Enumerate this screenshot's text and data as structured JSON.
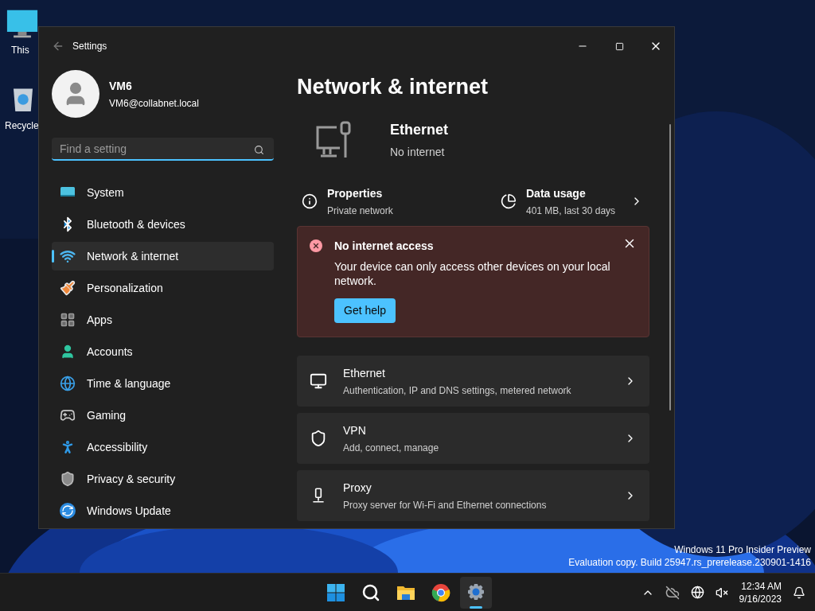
{
  "desktop_icons": [
    {
      "label": "This"
    },
    {
      "label": "Recycle"
    }
  ],
  "window": {
    "title": "Settings"
  },
  "account": {
    "name": "VM6",
    "email": "VM6@collabnet.local"
  },
  "search": {
    "placeholder": "Find a setting"
  },
  "nav": [
    {
      "label": "System",
      "selected": false
    },
    {
      "label": "Bluetooth & devices",
      "selected": false
    },
    {
      "label": "Network & internet",
      "selected": true
    },
    {
      "label": "Personalization",
      "selected": false
    },
    {
      "label": "Apps",
      "selected": false
    },
    {
      "label": "Accounts",
      "selected": false
    },
    {
      "label": "Time & language",
      "selected": false
    },
    {
      "label": "Gaming",
      "selected": false
    },
    {
      "label": "Accessibility",
      "selected": false
    },
    {
      "label": "Privacy & security",
      "selected": false
    },
    {
      "label": "Windows Update",
      "selected": false
    }
  ],
  "page_title": "Network & internet",
  "connection": {
    "name": "Ethernet",
    "status": "No internet"
  },
  "summary": [
    {
      "title": "Properties",
      "subtitle": "Private network",
      "chevron": false
    },
    {
      "title": "Data usage",
      "subtitle": "401 MB, last 30 days",
      "chevron": true
    }
  ],
  "alert": {
    "title": "No internet access",
    "message": "Your device can only access other devices on your local network.",
    "button": "Get help"
  },
  "settings_rows": [
    {
      "title": "Ethernet",
      "subtitle": "Authentication, IP and DNS settings, metered network"
    },
    {
      "title": "VPN",
      "subtitle": "Add, connect, manage"
    },
    {
      "title": "Proxy",
      "subtitle": "Proxy server for Wi-Fi and Ethernet connections"
    }
  ],
  "desktop_notice": [
    "Windows 11 Pro Insider Preview",
    "Evaluation copy. Build 25947.rs_prerelease.230901-1416"
  ],
  "taskbar": {
    "apps": [
      {
        "selected": false
      },
      {
        "selected": false
      },
      {
        "selected": false
      },
      {
        "selected": false
      },
      {
        "selected": true
      }
    ],
    "time": "12:34 AM",
    "date": "9/16/2023"
  }
}
